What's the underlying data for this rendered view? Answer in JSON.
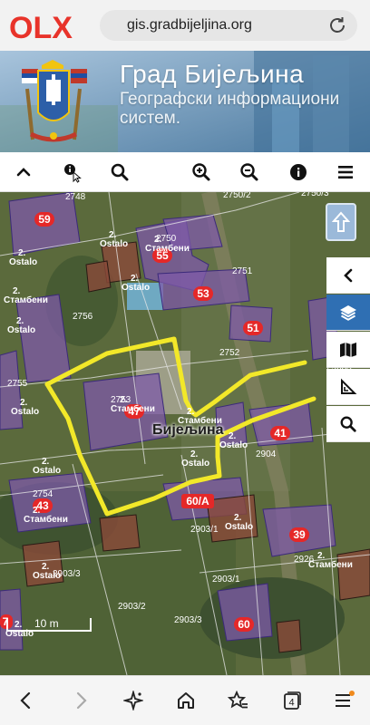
{
  "browser": {
    "url": "gis.gradbijeljina.org",
    "brand": "OLX"
  },
  "banner": {
    "title": "Град Бијељина",
    "subtitle": "Географски информациони систем."
  },
  "toolbar": {
    "items": [
      "collapse-up",
      "identify-cursor",
      "search",
      "zoom-in",
      "zoom-out",
      "info",
      "menu"
    ]
  },
  "map": {
    "street_label": "Бијељина",
    "scale_label": "10 m",
    "object_numbers": [
      "59",
      "55",
      "53",
      "51",
      "47",
      "41",
      "43",
      "60/A",
      "39",
      "60",
      "7"
    ],
    "parcel_numbers": [
      "2748",
      "2750/2",
      "2750/3",
      "2750",
      "2751",
      "2756",
      "2752",
      "2753",
      "2903/2",
      "2904",
      "2754",
      "2903/1",
      "2903/3",
      "2926",
      "2755",
      "2903/1",
      "2903/2",
      "2903/3"
    ],
    "land_use_labels": [
      "Ostalo",
      "Стамбени"
    ],
    "building_marker": "2.",
    "overlay_color": "#f2e829"
  },
  "side_panel": {
    "items": [
      "collapse-left",
      "layers",
      "map",
      "measure",
      "search"
    ],
    "active": "layers"
  },
  "nav": {
    "tab_count": "4",
    "items": [
      "back",
      "forward",
      "assistant",
      "home",
      "favorites",
      "tabs",
      "menu"
    ]
  }
}
